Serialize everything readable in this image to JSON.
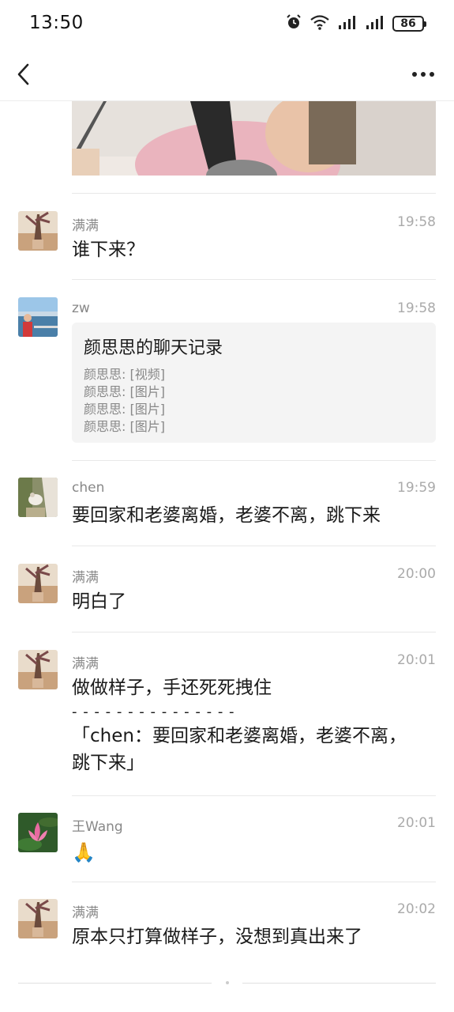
{
  "status_bar": {
    "time": "13:50",
    "battery": "86"
  },
  "header": {
    "back_icon": "chevron-left-icon",
    "more_icon": "more-horizontal-icon"
  },
  "messages": [
    {
      "sender": "满满",
      "time": "19:58",
      "text": "谁下来？"
    },
    {
      "sender": "zw",
      "time": "19:58",
      "record": {
        "title": "颜思思的聊天记录",
        "lines": [
          "颜思思: [视频]",
          "颜思思: [图片]",
          "颜思思: [图片]",
          "颜思思: [图片]"
        ]
      }
    },
    {
      "sender": "chen",
      "time": "19:59",
      "text": "要回家和老婆离婚，老婆不离，跳下来"
    },
    {
      "sender": "满满",
      "time": "20:00",
      "text": "明白了"
    },
    {
      "sender": "满满",
      "time": "20:01",
      "text": "做做样子，手还死死拽住",
      "separator": "- - - - - - - - - - - - - - -",
      "quote_line1": "「chen：要回家和老婆离婚，老婆不离，",
      "quote_line2": "跳下来」"
    },
    {
      "sender": "王Wang",
      "time": "20:01",
      "emoji": "🙏"
    },
    {
      "sender": "满满",
      "time": "20:02",
      "text": "原本只打算做样子，没想到真出来了"
    }
  ]
}
